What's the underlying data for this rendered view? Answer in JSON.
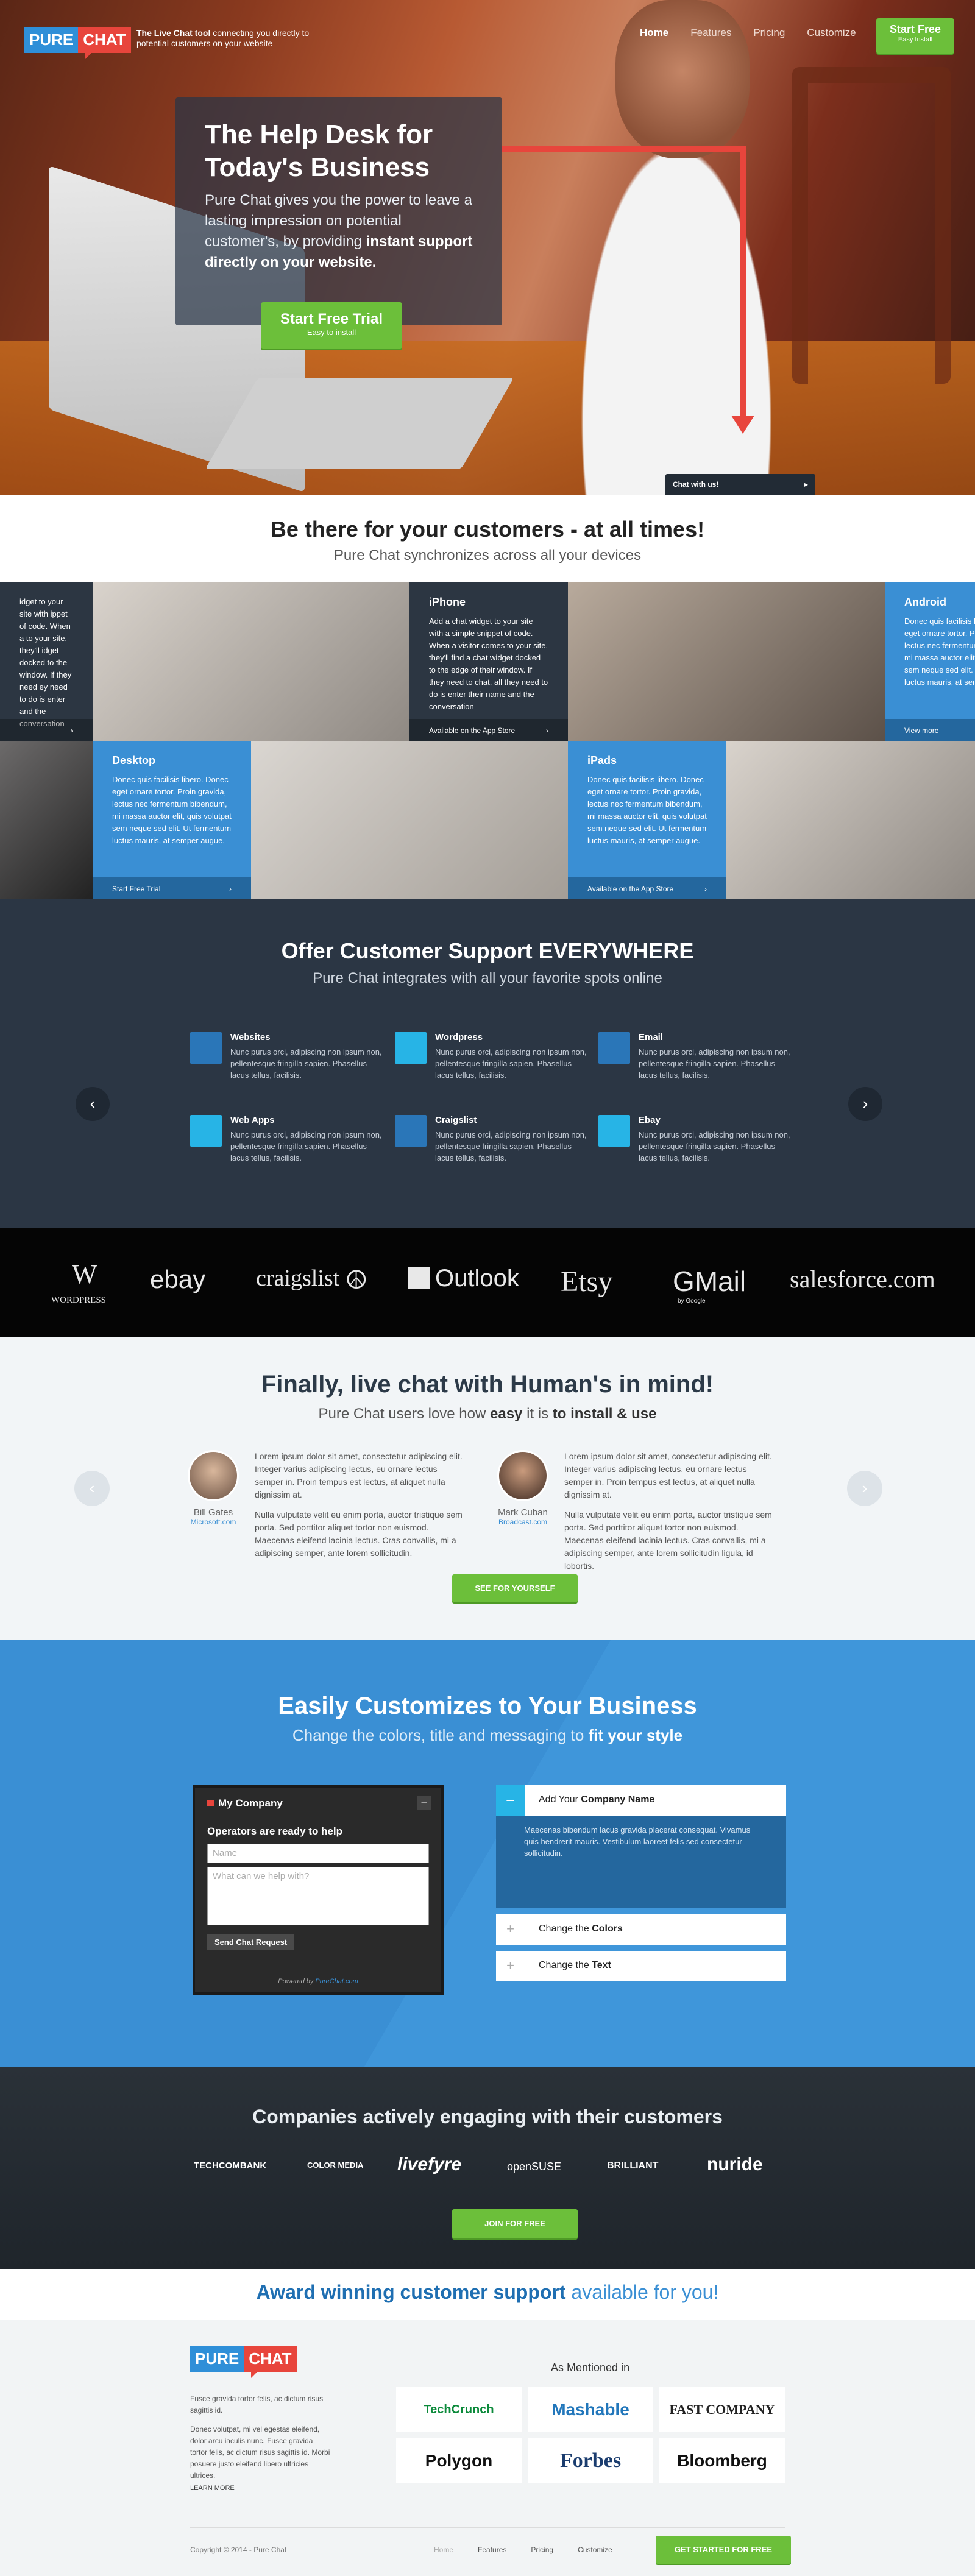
{
  "hero": {
    "logo_pure": "PURE",
    "logo_chat": "CHAT",
    "tagline_bold": "The Live Chat tool",
    "tagline_rest": " connecting you directly to potential customers on your website",
    "nav": [
      "Home",
      "Features",
      "Pricing",
      "Customize"
    ],
    "nav_cta_line1": "Start Free",
    "nav_cta_line2": "Easy Install",
    "title": "The Help Desk for Today's Business",
    "desc_plain": "Pure Chat gives you the power to leave a lasting impression on potential customer's, by providing ",
    "desc_bold": "instant support directly on your website.",
    "cta_line1": "Start Free Trial",
    "cta_line2": "Easy to install",
    "chat_tab": "Chat with us!",
    "chat_tab_icon": "arrow-right-icon"
  },
  "be_there": {
    "title_plain": "Be there for your customers - ",
    "title_bold": "at all times!",
    "subtitle": "Pure Chat synchronizes across all your devices"
  },
  "devices": {
    "cards": [
      {
        "title": "",
        "text": "idget to your site with ippet of code. When a to your site, they'll idget docked to the window. If they need ey need to do is enter and the conversation",
        "footer": "",
        "arrow": "›"
      },
      {
        "title": "iPhone",
        "text": "Add a chat widget to your site with a simple snippet of code. When a visitor comes to your site, they'll find a chat widget docked to the edge of their window. If they need to chat, all they need to do is enter their name and the conversation",
        "footer": "Available on the App Store",
        "arrow": "›"
      },
      {
        "title": "Android",
        "text": "Donec quis facilisis ligo. Donec eget ornare tortor. Proin gravida, lectus nec fermentum bibendum, mi massa auctor elit, quis volutpat sem neque sed elit. Ut fermentum luctus mauris, at semper augue.",
        "footer": "View more",
        "arrow": "›"
      },
      {
        "title": "Desktop",
        "text": "Donec quis facilisis libero. Donec eget ornare tortor. Proin gravida, lectus nec fermentum bibendum, mi massa auctor elit, quis volutpat sem neque sed elit. Ut fermentum luctus mauris, at semper augue.",
        "footer": "Start Free Trial",
        "arrow": "›"
      },
      {
        "title": "iPads",
        "text": "Donec quis facilisis libero. Donec eget ornare tortor. Proin gravida, lectus nec fermentum bibendum, mi massa auctor elit, quis volutpat sem neque sed elit. Ut fermentum luctus mauris, at semper augue.",
        "footer": "Available on the App Store",
        "arrow": "›"
      }
    ]
  },
  "offer": {
    "title_plain": "Offer Customer Support ",
    "title_bold": "EVERYWHERE",
    "subtitle": "Pure Chat integrates with all your favorite spots online",
    "features": [
      {
        "title": "Websites",
        "icon": "leaf-icon",
        "text": "Nunc purus orci, adipiscing non ipsum non, pellentesque fringilla sapien. Phasellus lacus tellus, facilisis."
      },
      {
        "title": "Wordpress",
        "icon": "monitor-icon",
        "text": "Nunc purus orci, adipiscing non ipsum non, pellentesque fringilla sapien. Phasellus lacus tellus, facilisis."
      },
      {
        "title": "Email",
        "icon": "camera-icon",
        "text": "Nunc purus orci, adipiscing non ipsum non, pellentesque fringilla sapien. Phasellus lacus tellus, facilisis."
      },
      {
        "title": "Web Apps",
        "icon": "building-icon",
        "text": "Nunc purus orci, adipiscing non ipsum non, pellentesque fringilla sapien. Phasellus lacus tellus, facilisis."
      },
      {
        "title": "Craigslist",
        "icon": "hammer-icon",
        "text": "Nunc purus orci, adipiscing non ipsum non, pellentesque fringilla sapien. Phasellus lacus tellus, facilisis."
      },
      {
        "title": "Ebay",
        "icon": "tag-icon",
        "text": "Nunc purus orci, adipiscing non ipsum non, pellentesque fringilla sapien. Phasellus lacus tellus, facilisis."
      }
    ],
    "prev": "‹",
    "next": "›"
  },
  "brands": [
    "W",
    "WORDPRESS",
    "ebay",
    "craigslist",
    "☮",
    "Outlook",
    "Etsy",
    "GMail",
    "by Google",
    "salesforce.com"
  ],
  "human": {
    "title_bold1": "Finally",
    "title_mid": ", live chat with ",
    "title_bold2": "Human",
    "title_end": "'s in mind!",
    "sub_a": "Pure Chat users love how ",
    "sub_b": "easy",
    "sub_c": " it is ",
    "sub_d": "to install & use",
    "testimonials": [
      {
        "name": "Bill Gates",
        "company": "Microsoft.com",
        "p1": "Lorem ipsum dolor sit amet, consectetur adipiscing elit. Integer varius adipiscing lectus, eu ornare lectus semper in. Proin tempus est lectus, at aliquet nulla dignissim at.",
        "p2": "Nulla vulputate velit eu enim porta, auctor tristique sem porta. Sed porttitor aliquet tortor non euismod. Maecenas eleifend lacinia lectus. Cras convallis, mi a adipiscing semper, ante lorem sollicitudin."
      },
      {
        "name": "Mark Cuban",
        "company": "Broadcast.com",
        "p1": "Lorem ipsum dolor sit amet, consectetur adipiscing elit. Integer varius adipiscing lectus, eu ornare lectus semper in. Proin tempus est lectus, at aliquet nulla dignissim at.",
        "p2": "Nulla vulputate velit eu enim porta, auctor tristique sem porta. Sed porttitor aliquet tortor non euismod. Maecenas eleifend lacinia lectus. Cras convallis, mi a adipiscing semper, ante lorem sollicitudin ligula, id lobortis."
      }
    ],
    "cta": "SEE FOR YOURSELF",
    "prev": "‹",
    "next": "›"
  },
  "customize": {
    "title": "Easily Customizes to Your Business",
    "sub_plain": "Change the colors, title and messaging to ",
    "sub_bold": "fit your style",
    "widget": {
      "company": "My Company",
      "minimize": "–",
      "prompt": "Operators are ready to help",
      "name_placeholder": "Name",
      "msg_placeholder": "What can we help with?",
      "send": "Send Chat Request",
      "powered_plain": "Powered by ",
      "powered_link": "PureChat.com"
    },
    "accordion": [
      {
        "sign": "–",
        "plain": "Add Your ",
        "bold": "Company Name",
        "body": "Maecenas bibendum lacus gravida placerat consequat. Vivamus quis hendrerit mauris. Vestibulum laoreet felis sed consectetur sollicitudin."
      },
      {
        "sign": "+",
        "plain": "Change the ",
        "bold": "Colors"
      },
      {
        "sign": "+",
        "plain": "Change the ",
        "bold": "Text"
      }
    ]
  },
  "companies": {
    "title_a": "Companies ",
    "title_b": "actively engaging",
    "title_c": " with their ",
    "title_d": "customers",
    "logos": [
      "TECHCOMBANK",
      "COLOR MEDIA",
      "livefyre",
      "openSUSE",
      "BRILLIANT",
      "nuride"
    ],
    "cta": "JOIN FOR FREE"
  },
  "award": {
    "bold": "Award winning customer support",
    "rest": " available for you!"
  },
  "footer": {
    "logo_pure": "PURE",
    "logo_chat": "CHAT",
    "p1": "Fusce gravida tortor felis, ac dictum risus sagittis id.",
    "p2": "Donec volutpat, mi vel egestas eleifend, dolor arcu iaculis nunc. Fusce gravida tortor felis, ac dictum risus sagittis id. Morbi posuere justo eleifend libero ultricies ultrices.",
    "learn": "LEARN MORE",
    "mentioned": "As Mentioned in",
    "pubs": [
      "TechCrunch",
      "Mashable",
      "FAST COMPANY",
      "Polygon",
      "Forbes",
      "Bloomberg"
    ],
    "copyright": "Copyright © 2014 - Pure Chat",
    "nav": [
      "Home",
      "Features",
      "Pricing",
      "Customize"
    ],
    "cta": "GET STARTED FOR FREE"
  },
  "colors": {
    "brand_blue": "#2f8fd8",
    "brand_red": "#e8453c",
    "cta_green": "#6cbf3a",
    "dark_slate": "#2b3644",
    "accent_blue": "#3a8fd4"
  }
}
